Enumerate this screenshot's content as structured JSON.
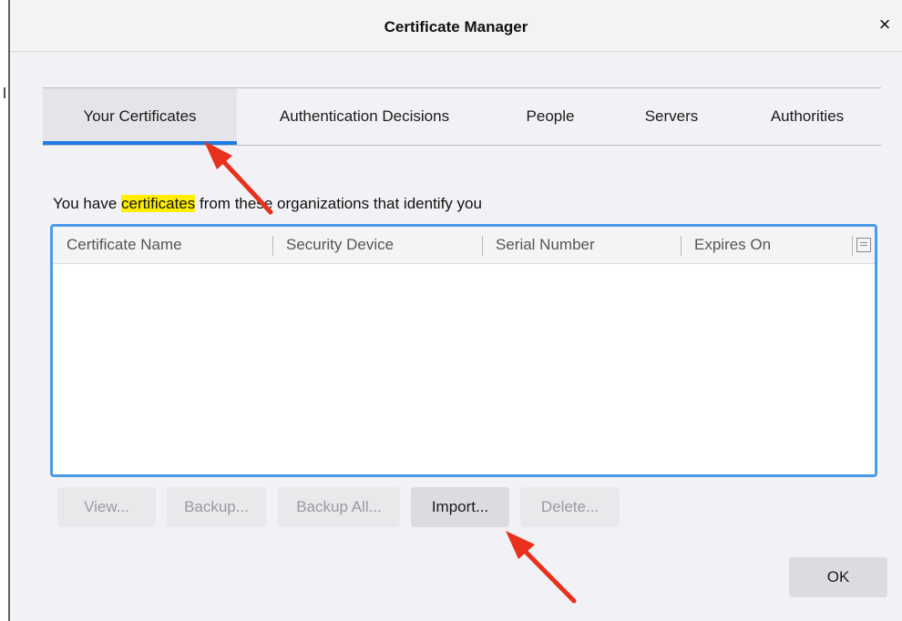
{
  "dialog": {
    "title": "Certificate Manager",
    "close_glyph": "×"
  },
  "tabs": [
    {
      "label": "Your Certificates",
      "selected": true
    },
    {
      "label": "Authentication Decisions",
      "selected": false
    },
    {
      "label": "People",
      "selected": false
    },
    {
      "label": "Servers",
      "selected": false
    },
    {
      "label": "Authorities",
      "selected": false
    }
  ],
  "info": {
    "before": "You have ",
    "highlight": "certificates",
    "after": " from these organizations that identify you"
  },
  "table": {
    "columns": [
      "Certificate Name",
      "Security Device",
      "Serial Number",
      "Expires On"
    ],
    "rows": []
  },
  "buttons": {
    "view": "View...",
    "backup": "Backup...",
    "backup_all": "Backup All...",
    "import": "Import...",
    "delete": "Delete...",
    "ok": "OK"
  },
  "colors": {
    "accent": "#1a7ae6",
    "highlight": "#ffee00",
    "annotation_arrow": "#e8301c"
  },
  "icons": {
    "close": "close-icon",
    "column_picker": "column-picker-icon"
  }
}
